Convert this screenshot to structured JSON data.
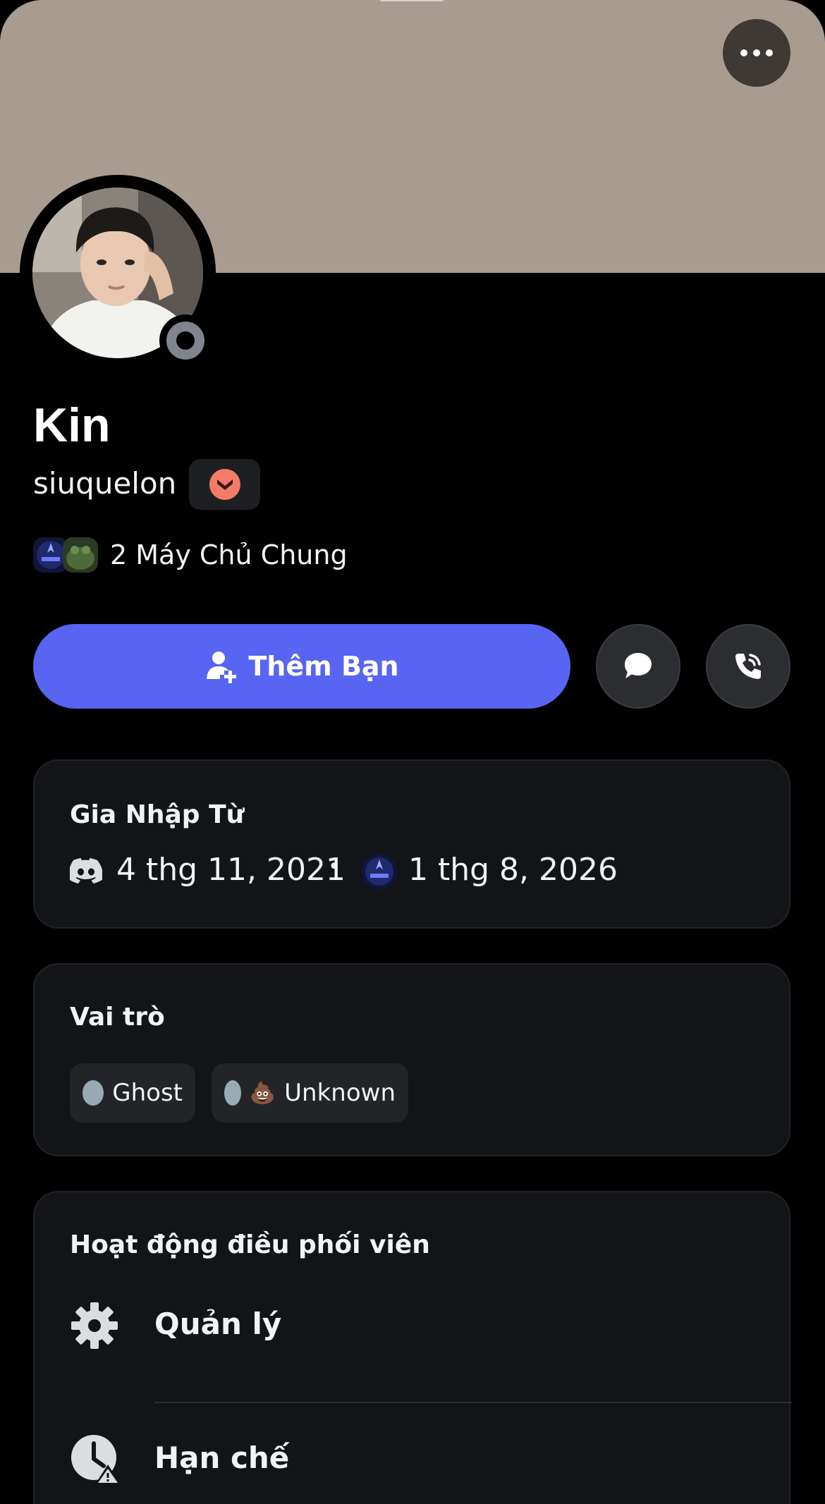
{
  "profile": {
    "display_name": "Kin",
    "username": "siuquelon",
    "status": "offline"
  },
  "mutual": {
    "text": "2 Máy Chủ Chung"
  },
  "actions": {
    "add_friend_label": "Thêm Bạn"
  },
  "member_since": {
    "title": "Gia Nhập Từ",
    "discord_date": "4 thg 11, 2021",
    "separator": "•",
    "server_date": "1 thg 8, 2026"
  },
  "roles": {
    "title": "Vai trò",
    "items": [
      {
        "label": "Ghost",
        "color": "#99aab5"
      },
      {
        "label": "Unknown",
        "color": "#99aab5",
        "emoji": "💩"
      }
    ]
  },
  "moderation": {
    "title": "Hoạt động điều phối viên",
    "items": [
      {
        "label": "Quản lý",
        "icon": "gear-icon"
      },
      {
        "label": "Hạn chế",
        "icon": "timeout-clock-icon"
      }
    ]
  },
  "colors": {
    "banner": "#a89c90",
    "accent": "#5865f2",
    "background": "#000000",
    "card": "#131418"
  }
}
